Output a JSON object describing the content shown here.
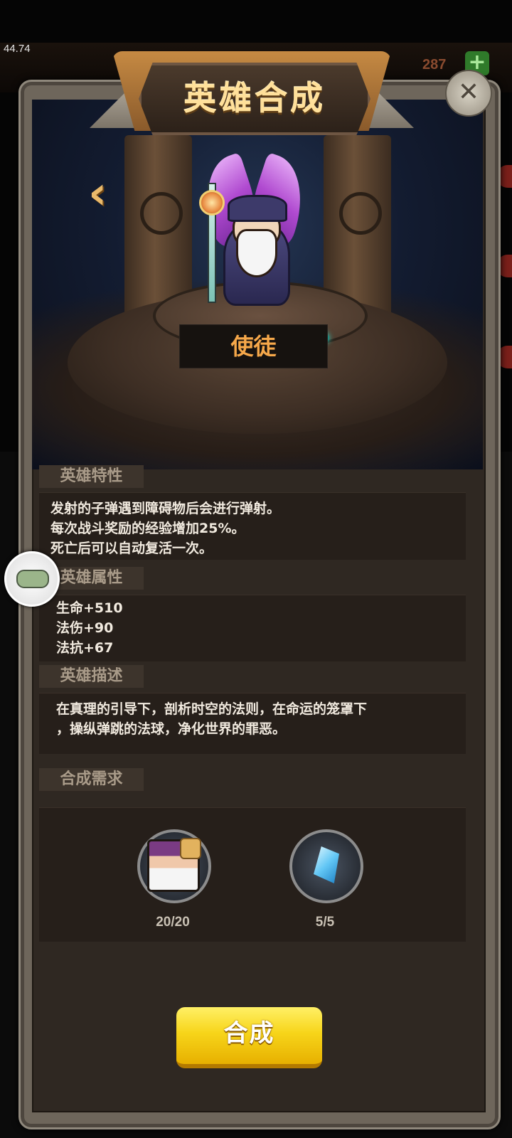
{
  "status": {
    "fps": "44.74"
  },
  "background": {
    "counter": "287"
  },
  "title": "英雄合成",
  "hero": {
    "name": "使徒"
  },
  "traits": {
    "label": "英雄特性",
    "lines": [
      "发射的子弹遇到障碍物后会进行弹射。",
      "每次战斗奖励的经验增加25%。",
      "死亡后可以自动复活一次。"
    ]
  },
  "attributes": {
    "label": "英雄属性",
    "lines": [
      "生命+510",
      "法伤+90",
      "法抗+67"
    ]
  },
  "description": {
    "label": "英雄描述",
    "lines": [
      "在真理的引导下，剖析时空的法则，在命运的笼罩下",
      "，操纵弹跳的法球，净化世界的罪恶。"
    ]
  },
  "requirements": {
    "label": "合成需求",
    "items": [
      {
        "icon": "hero-fragment-icon",
        "count": "20/20"
      },
      {
        "icon": "blue-crystal-icon",
        "count": "5/5"
      }
    ]
  },
  "buttons": {
    "compose": "合成"
  },
  "colors": {
    "title": "#ffe09a",
    "hero_name": "#f6a84a",
    "compose_button": "#f7d51a"
  }
}
